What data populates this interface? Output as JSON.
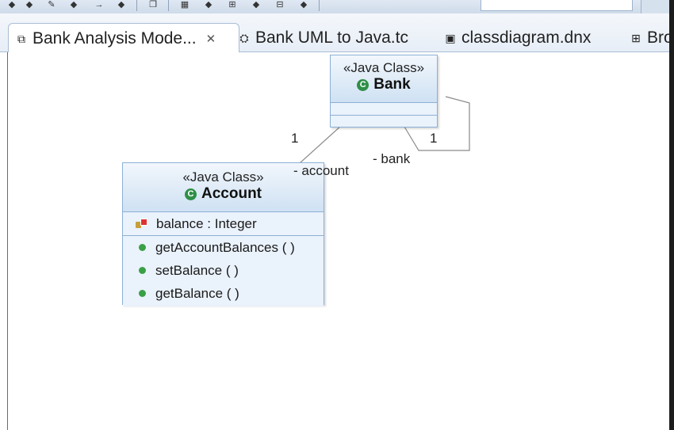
{
  "toolbar": {
    "icons": [
      "diamond-icon",
      "diamond-icon",
      "pencil-icon",
      "diamond-icon",
      "arrow-right-icon",
      "diamond-icon",
      "copy-icon",
      "grid-icon",
      "diamond-icon",
      "layout-icon",
      "diamond-icon",
      "tree-icon",
      "diamond-icon"
    ]
  },
  "tabs": [
    {
      "label": "Bank Analysis Mode...",
      "icon": "model-icon",
      "active": true
    },
    {
      "label": "Bank UML to Java.tc",
      "icon": "transform-icon",
      "active": false
    },
    {
      "label": "classdiagram.dnx",
      "icon": "diagram-icon",
      "active": false
    },
    {
      "label": "Bro",
      "icon": "browse-icon",
      "active": false
    }
  ],
  "diagram": {
    "classes": {
      "bank": {
        "stereotype": "«Java Class»",
        "name": "Bank",
        "attributes": [],
        "operations": []
      },
      "account": {
        "stereotype": "«Java Class»",
        "name": "Account",
        "attributes": [
          {
            "text": "balance : Integer"
          }
        ],
        "operations": [
          {
            "text": "getAccountBalances ( )"
          },
          {
            "text": "setBalance ( )"
          },
          {
            "text": "getBalance ( )"
          }
        ]
      }
    },
    "associations": {
      "bank_account": {
        "multiplicity": "1",
        "role": "- account"
      },
      "bank_self": {
        "multiplicity": "1",
        "role": "- bank"
      }
    }
  },
  "colors": {
    "class_fill": "#dce9f6",
    "class_border": "#8cb0d6",
    "method_dot": "#3aa046",
    "class_icon": "#2f8f47"
  }
}
